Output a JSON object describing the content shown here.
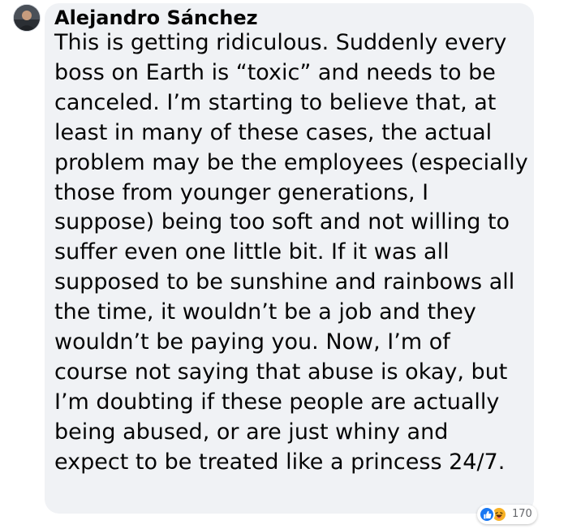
{
  "comment": {
    "author": "Alejandro Sánchez",
    "text": "This is getting ridiculous. Suddenly every boss on Earth is “toxic” and needs to be canceled. I’m starting to believe that, at least in many of these cases, the actual problem may be the employees (especially those from younger generations, I suppose) being too soft and not willing to suffer even one little bit. If it was all supposed to be sunshine and rainbows all the time, it wouldn’t be a job and they wouldn’t be paying you. Now, I’m of course not saying that abuse is okay, but I’m doubting if these people are actually being abused, or are just whiny and expect to be treated like a princess 24/7."
  },
  "reactions": {
    "icons": [
      "like-icon",
      "haha-icon"
    ],
    "count": "170"
  },
  "colors": {
    "bubble": "#f0f2f5",
    "text": "#050505",
    "like": "#1877f2",
    "haha": "#f7b125",
    "muted": "#65676b"
  }
}
